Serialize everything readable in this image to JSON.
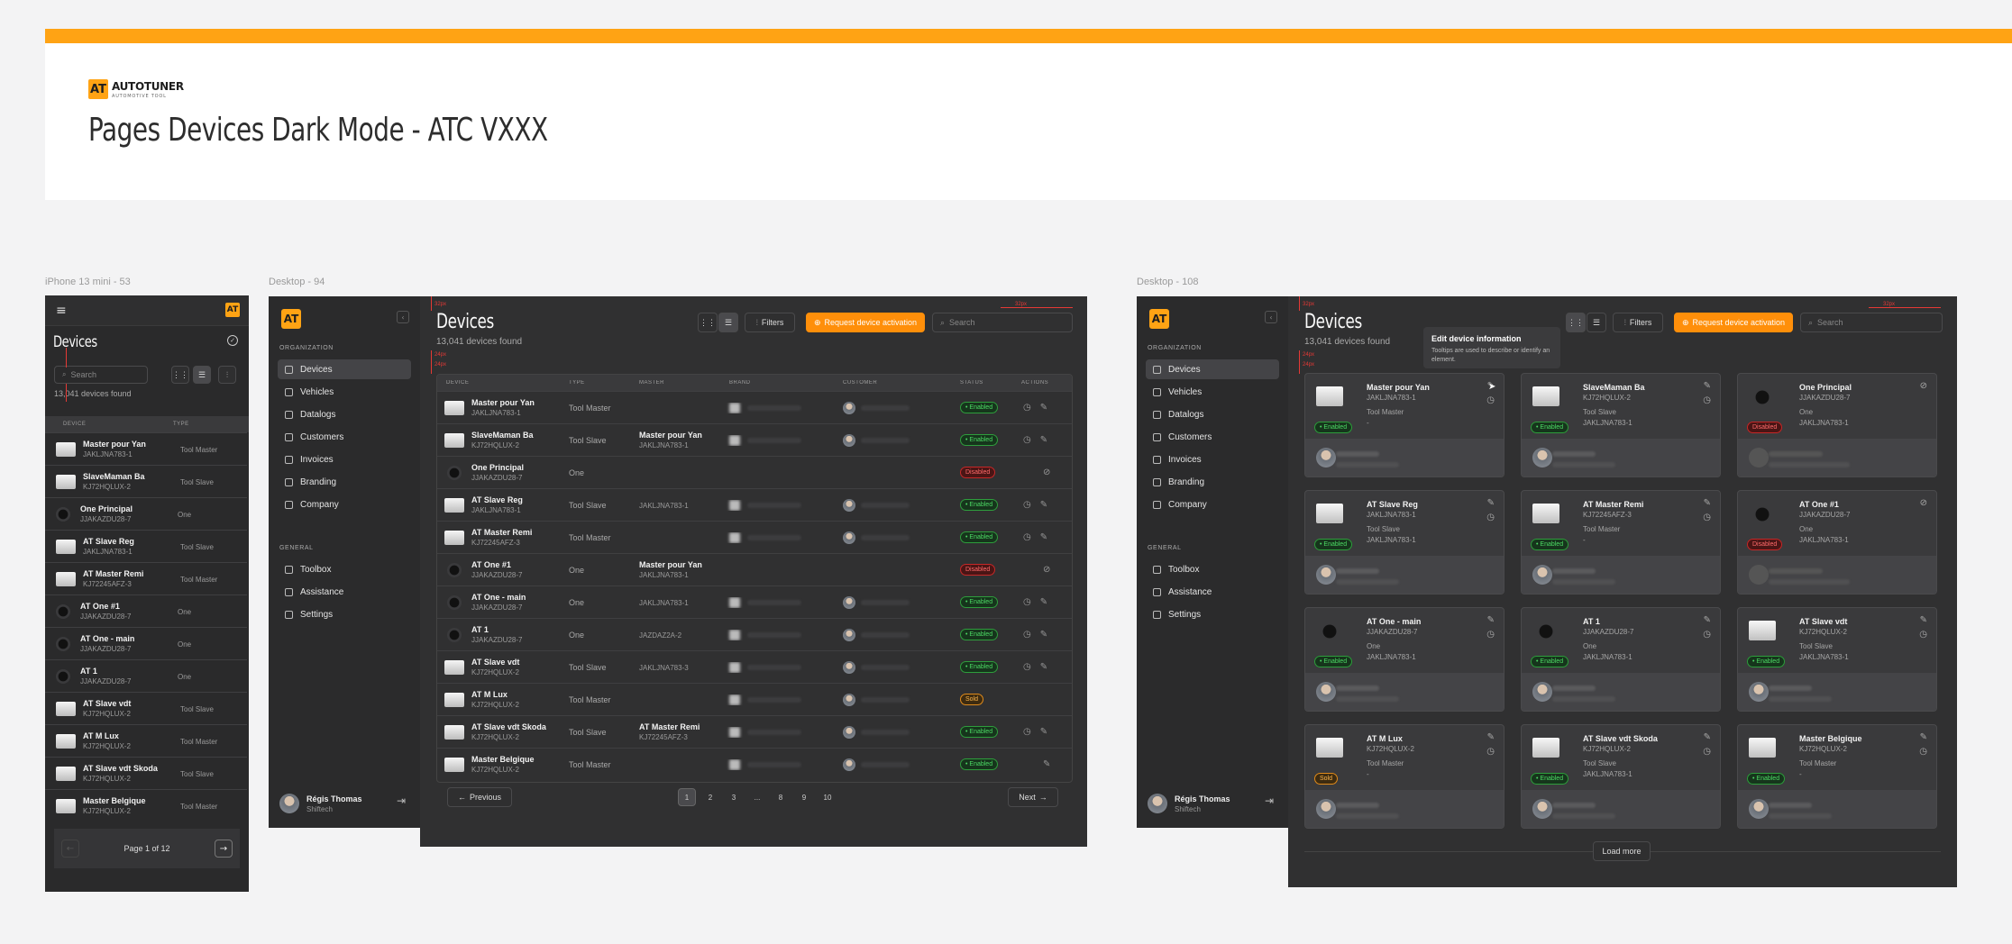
{
  "header": {
    "logo_text": "AT",
    "brand_name": "AUTOTUNER",
    "brand_tagline": "AUTOMOTIVE TOOL",
    "title": "Pages Devices Dark Mode - ATC VXXX"
  },
  "frames": {
    "mobile_label": "iPhone 13 mini - 53",
    "desktop_list_label": "Desktop - 94",
    "desktop_grid_label": "Desktop - 108"
  },
  "colors": {
    "accent": "#ffa314",
    "button_orange": "#ff8f0a",
    "background_dark": "#2a2a2b",
    "status_enabled": "#4cd964",
    "status_disabled": "#c62828",
    "status_sold": "#e08b1c"
  },
  "sidebar": {
    "logo_text": "AT",
    "collapse_icon": "chevron-left-icon",
    "org_section": "ORGANIZATION",
    "items": [
      {
        "label": "Devices",
        "icon": "device-icon"
      },
      {
        "label": "Vehicles",
        "icon": "car-icon"
      },
      {
        "label": "Datalogs",
        "icon": "chart-icon"
      },
      {
        "label": "Customers",
        "icon": "users-icon"
      },
      {
        "label": "Invoices",
        "icon": "invoice-icon"
      },
      {
        "label": "Branding",
        "icon": "brush-icon"
      },
      {
        "label": "Company",
        "icon": "building-icon"
      }
    ],
    "general_section": "GENERAL",
    "general_items": [
      {
        "label": "Toolbox",
        "icon": "toolbox-icon"
      },
      {
        "label": "Assistance",
        "icon": "help-icon"
      },
      {
        "label": "Settings",
        "icon": "gear-icon"
      }
    ],
    "user": {
      "name": "Régis Thomas",
      "company": "Shiftech"
    }
  },
  "page": {
    "title": "Devices",
    "subtitle": "13,041 devices found",
    "filters_label": "Filters",
    "activation_label": "Request device activation",
    "search_placeholder": "Search",
    "load_more": "Load more"
  },
  "rulers": {
    "r1": "32px",
    "r2": "32px",
    "r3": "24px",
    "r4": "24px"
  },
  "table": {
    "columns": [
      "DEVICE",
      "TYPE",
      "MASTER",
      "BRAND",
      "CUSTOMER",
      "STATUS",
      "ACTIONS"
    ],
    "rows": [
      {
        "name": "Master pour Yan",
        "serial": "JAKLJNA783-1",
        "type": "Tool Master",
        "master": "",
        "master_serial": "",
        "status": "Enabled",
        "thumb": "light",
        "customer": true,
        "edit": true
      },
      {
        "name": "SlaveMaman Ba",
        "serial": "KJ72HQLUX-2",
        "type": "Tool Slave",
        "master": "Master pour Yan",
        "master_serial": "JAKLJNA783-1",
        "status": "Enabled",
        "thumb": "light",
        "customer": true,
        "edit": true
      },
      {
        "name": "One Principal",
        "serial": "JJAKAZDU28-7",
        "type": "One",
        "master": "",
        "master_serial": "",
        "status": "Disabled",
        "thumb": "dark",
        "customer": false,
        "edit": false
      },
      {
        "name": "AT Slave Reg",
        "serial": "JAKLJNA783-1",
        "type": "Tool Slave",
        "master": "",
        "master_serial": "JAKLJNA783-1",
        "status": "Enabled",
        "thumb": "light",
        "customer": true,
        "edit": true
      },
      {
        "name": "AT Master Remi",
        "serial": "KJ72245AFZ-3",
        "type": "Tool Master",
        "master": "",
        "master_serial": "",
        "status": "Enabled",
        "thumb": "light",
        "customer": true,
        "edit": true
      },
      {
        "name": "AT One #1",
        "serial": "JJAKAZDU28-7",
        "type": "One",
        "master": "Master pour Yan",
        "master_serial": "JAKLJNA783-1",
        "status": "Disabled",
        "thumb": "dark",
        "customer": false,
        "edit": false
      },
      {
        "name": "AT One - main",
        "serial": "JJAKAZDU28-7",
        "type": "One",
        "master": "",
        "master_serial": "JAKLJNA783-1",
        "status": "Enabled",
        "thumb": "dark",
        "customer": true,
        "edit": true
      },
      {
        "name": "AT 1",
        "serial": "JJAKAZDU28-7",
        "type": "One",
        "master": "",
        "master_serial": "JAZDAZ2A-2",
        "status": "Enabled",
        "thumb": "dark",
        "customer": true,
        "edit": true
      },
      {
        "name": "AT Slave vdt",
        "serial": "KJ72HQLUX-2",
        "type": "Tool Slave",
        "master": "",
        "master_serial": "JAKLJNA783-3",
        "status": "Enabled",
        "thumb": "light",
        "customer": true,
        "edit": true
      },
      {
        "name": "AT M Lux",
        "serial": "KJ72HQLUX-2",
        "type": "Tool Master",
        "master": "",
        "master_serial": "",
        "status": "Sold",
        "thumb": "light",
        "customer": true,
        "edit": false
      },
      {
        "name": "AT Slave vdt Skoda",
        "serial": "KJ72HQLUX-2",
        "type": "Tool Slave",
        "master": "AT Master Remi",
        "master_serial": "KJ72245AFZ-3",
        "status": "Enabled",
        "thumb": "light",
        "customer": true,
        "edit": true
      },
      {
        "name": "Master Belgique",
        "serial": "KJ72HQLUX-2",
        "type": "Tool Master",
        "master": "",
        "master_serial": "",
        "status": "Enabled",
        "thumb": "light",
        "customer": true,
        "edit": false
      }
    ]
  },
  "pagination": {
    "previous": "Previous",
    "next": "Next",
    "pages": [
      "1",
      "2",
      "3",
      "...",
      "8",
      "9",
      "10"
    ],
    "current": "1"
  },
  "mobile": {
    "title": "Devices",
    "subtitle": "13,041 devices found",
    "search_placeholder": "Search",
    "col_device": "DEVICE",
    "col_type": "TYPE",
    "page_label": "Page 1 of 12"
  },
  "tooltip": {
    "title": "Edit device information",
    "text": "Tooltips are used to describe or identify an element."
  },
  "cards": [
    {
      "name": "Master pour Yan",
      "serial": "JAKLJNA783-1",
      "type": "Tool Master",
      "master": "-",
      "status": "Enabled",
      "thumb": "light",
      "action": "edit"
    },
    {
      "name": "SlaveMaman Ba",
      "serial": "KJ72HQLUX-2",
      "type": "Tool Slave",
      "master": "JAKLJNA783-1",
      "status": "Enabled",
      "thumb": "light",
      "action": "edit"
    },
    {
      "name": "One Principal",
      "serial": "JJAKAZDU28-7",
      "type": "One",
      "master": "JAKLJNA783-1",
      "status": "Disabled",
      "thumb": "dark",
      "action": "check"
    },
    {
      "name": "AT Slave Reg",
      "serial": "JAKLJNA783-1",
      "type": "Tool Slave",
      "master": "JAKLJNA783-1",
      "status": "Enabled",
      "thumb": "light",
      "action": "edit"
    },
    {
      "name": "AT Master Remi",
      "serial": "KJ72245AFZ-3",
      "type": "Tool Master",
      "master": "-",
      "status": "Enabled",
      "thumb": "light",
      "action": "edit"
    },
    {
      "name": "AT One #1",
      "serial": "JJAKAZDU28-7",
      "type": "One",
      "master": "JAKLJNA783-1",
      "status": "Disabled",
      "thumb": "dark",
      "action": "check"
    },
    {
      "name": "AT One - main",
      "serial": "JJAKAZDU28-7",
      "type": "One",
      "master": "JAKLJNA783-1",
      "status": "Enabled",
      "thumb": "dark",
      "action": "edit"
    },
    {
      "name": "AT 1",
      "serial": "JJAKAZDU28-7",
      "type": "One",
      "master": "JAKLJNA783-1",
      "status": "Enabled",
      "thumb": "dark",
      "action": "edit"
    },
    {
      "name": "AT Slave vdt",
      "serial": "KJ72HQLUX-2",
      "type": "Tool Slave",
      "master": "JAKLJNA783-1",
      "status": "Enabled",
      "thumb": "light",
      "action": "edit"
    },
    {
      "name": "AT M Lux",
      "serial": "KJ72HQLUX-2",
      "type": "Tool Master",
      "master": "-",
      "status": "Sold",
      "thumb": "light",
      "action": "edit"
    },
    {
      "name": "AT Slave vdt Skoda",
      "serial": "KJ72HQLUX-2",
      "type": "Tool Slave",
      "master": "JAKLJNA783-1",
      "status": "Enabled",
      "thumb": "light",
      "action": "edit"
    },
    {
      "name": "Master Belgique",
      "serial": "KJ72HQLUX-2",
      "type": "Tool Master",
      "master": "-",
      "status": "Enabled",
      "thumb": "light",
      "action": "edit"
    }
  ]
}
